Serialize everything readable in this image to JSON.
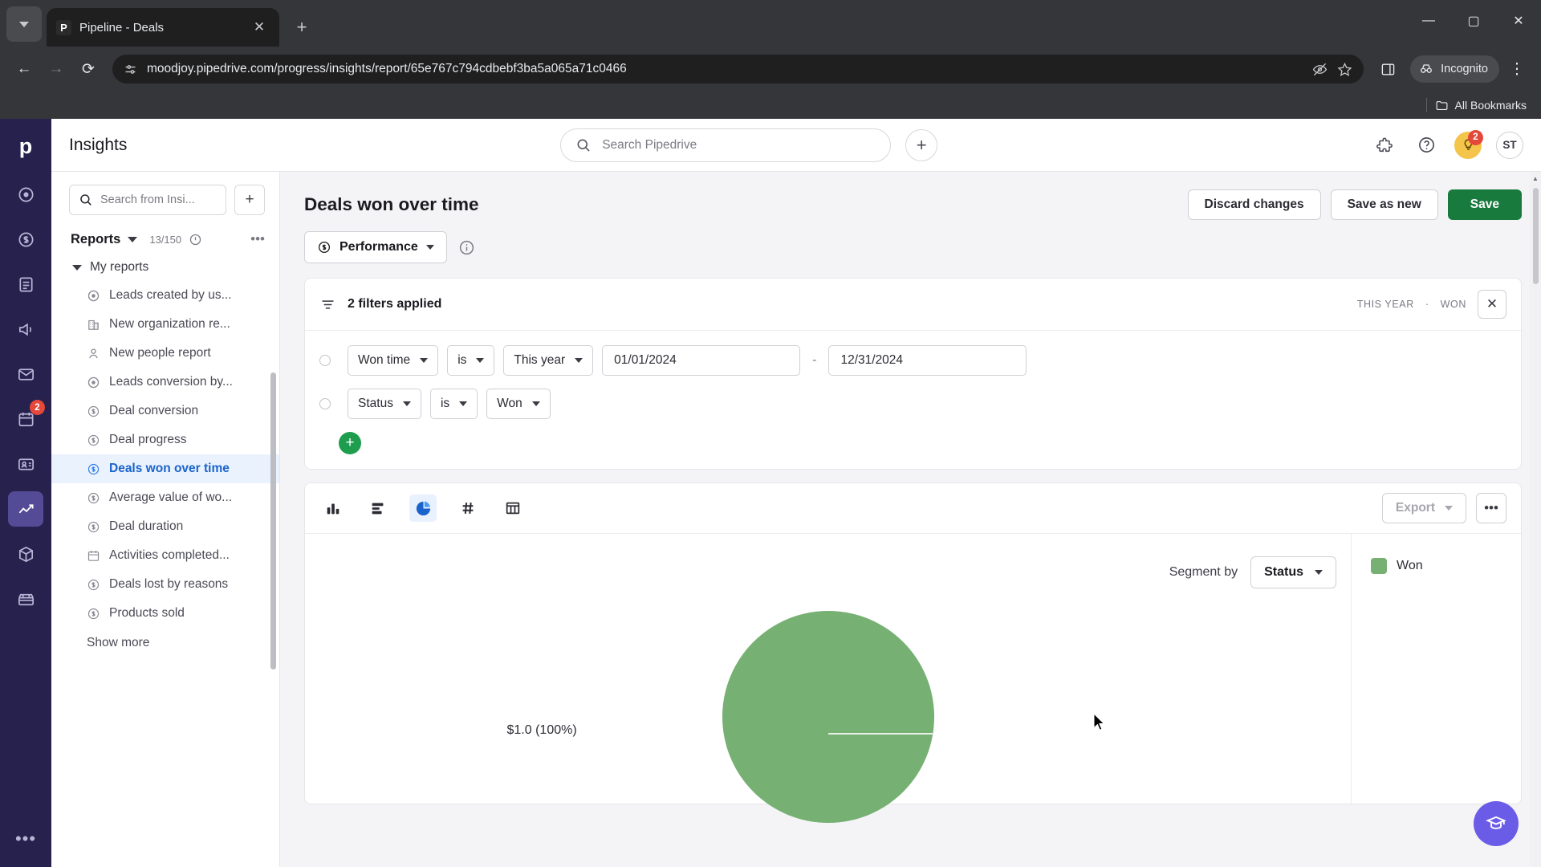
{
  "browser": {
    "tab": {
      "title": "Pipeline - Deals",
      "favicon_letter": "P"
    },
    "url": "moodjoy.pipedrive.com/progress/insights/report/65e767c794cdbebf3ba5a065a71c0466",
    "incognito_label": "Incognito",
    "bookmarks_label": "All Bookmarks"
  },
  "rail": {
    "logo": "p",
    "items": [
      {
        "name": "leads-icon",
        "badge": null
      },
      {
        "name": "deals-icon",
        "badge": null
      },
      {
        "name": "activities-icon",
        "badge": null
      },
      {
        "name": "campaigns-icon",
        "badge": null
      },
      {
        "name": "mail-icon",
        "badge": null
      },
      {
        "name": "calendar-icon",
        "badge": "2"
      },
      {
        "name": "contacts-icon",
        "badge": null
      },
      {
        "name": "insights-icon",
        "badge": null
      },
      {
        "name": "products-icon",
        "badge": null
      },
      {
        "name": "marketplace-icon",
        "badge": null
      }
    ],
    "more": "•••"
  },
  "appbar": {
    "title": "Insights",
    "search_placeholder": "Search Pipedrive",
    "notification_badge": "2",
    "avatar_initials": "ST"
  },
  "sidebar": {
    "search_placeholder": "Search from Insi...",
    "reports_label": "Reports",
    "reports_count": "13/150",
    "group_label": "My reports",
    "show_more": "Show more",
    "items": [
      {
        "label": "Leads created by us...",
        "icon": "target-icon",
        "active": false
      },
      {
        "label": "New organization re...",
        "icon": "organization-icon",
        "active": false
      },
      {
        "label": "New people report",
        "icon": "person-icon",
        "active": false
      },
      {
        "label": "Leads conversion by...",
        "icon": "target-icon",
        "active": false
      },
      {
        "label": "Deal conversion",
        "icon": "deal-icon",
        "active": false
      },
      {
        "label": "Deal progress",
        "icon": "deal-icon",
        "active": false
      },
      {
        "label": "Deals won over time",
        "icon": "deal-icon",
        "active": true
      },
      {
        "label": "Average value of wo...",
        "icon": "deal-icon",
        "active": false
      },
      {
        "label": "Deal duration",
        "icon": "deal-icon",
        "active": false
      },
      {
        "label": "Activities completed...",
        "icon": "calendar-icon",
        "active": false
      },
      {
        "label": "Deals lost by reasons",
        "icon": "deal-icon",
        "active": false
      },
      {
        "label": "Products sold",
        "icon": "deal-icon",
        "active": false
      }
    ]
  },
  "report": {
    "title": "Deals won over time",
    "discard_label": "Discard changes",
    "save_as_new_label": "Save as new",
    "save_label": "Save",
    "type_label": "Performance"
  },
  "filters": {
    "summary": "2 filters applied",
    "meta_period": "THIS YEAR",
    "meta_sep": "·",
    "meta_status": "WON",
    "rows": [
      {
        "field": "Won time",
        "operator": "is",
        "value": "This year",
        "date_from": "01/01/2024",
        "date_to": "12/31/2024",
        "has_dates": true
      },
      {
        "field": "Status",
        "operator": "is",
        "value": "Won",
        "has_dates": false
      }
    ]
  },
  "chart_toolbar": {
    "types": [
      {
        "name": "column-chart-icon",
        "active": false
      },
      {
        "name": "bar-chart-icon",
        "active": false
      },
      {
        "name": "pie-chart-icon",
        "active": true
      },
      {
        "name": "scorecard-icon",
        "active": false
      },
      {
        "name": "table-icon",
        "active": false
      }
    ],
    "export_label": "Export",
    "more_label": "•••"
  },
  "chart_data": {
    "type": "pie",
    "title": "Deals won over time",
    "segment_by_label": "Segment by",
    "segment_by_value": "Status",
    "categories": [
      "Won"
    ],
    "values": [
      1.0
    ],
    "value_labels": [
      "$1.0 (100%)"
    ],
    "colors": [
      "#76b072"
    ],
    "legend": [
      {
        "label": "Won",
        "color": "#76b072"
      }
    ],
    "legend_position": "right",
    "total": 1.0,
    "unit": "$"
  },
  "colors": {
    "accent_green": "#197a3d",
    "pie_green": "#76b072",
    "active_blue": "#1a63cc",
    "rail_purple": "#26214d",
    "badge_red": "#e4483b"
  }
}
